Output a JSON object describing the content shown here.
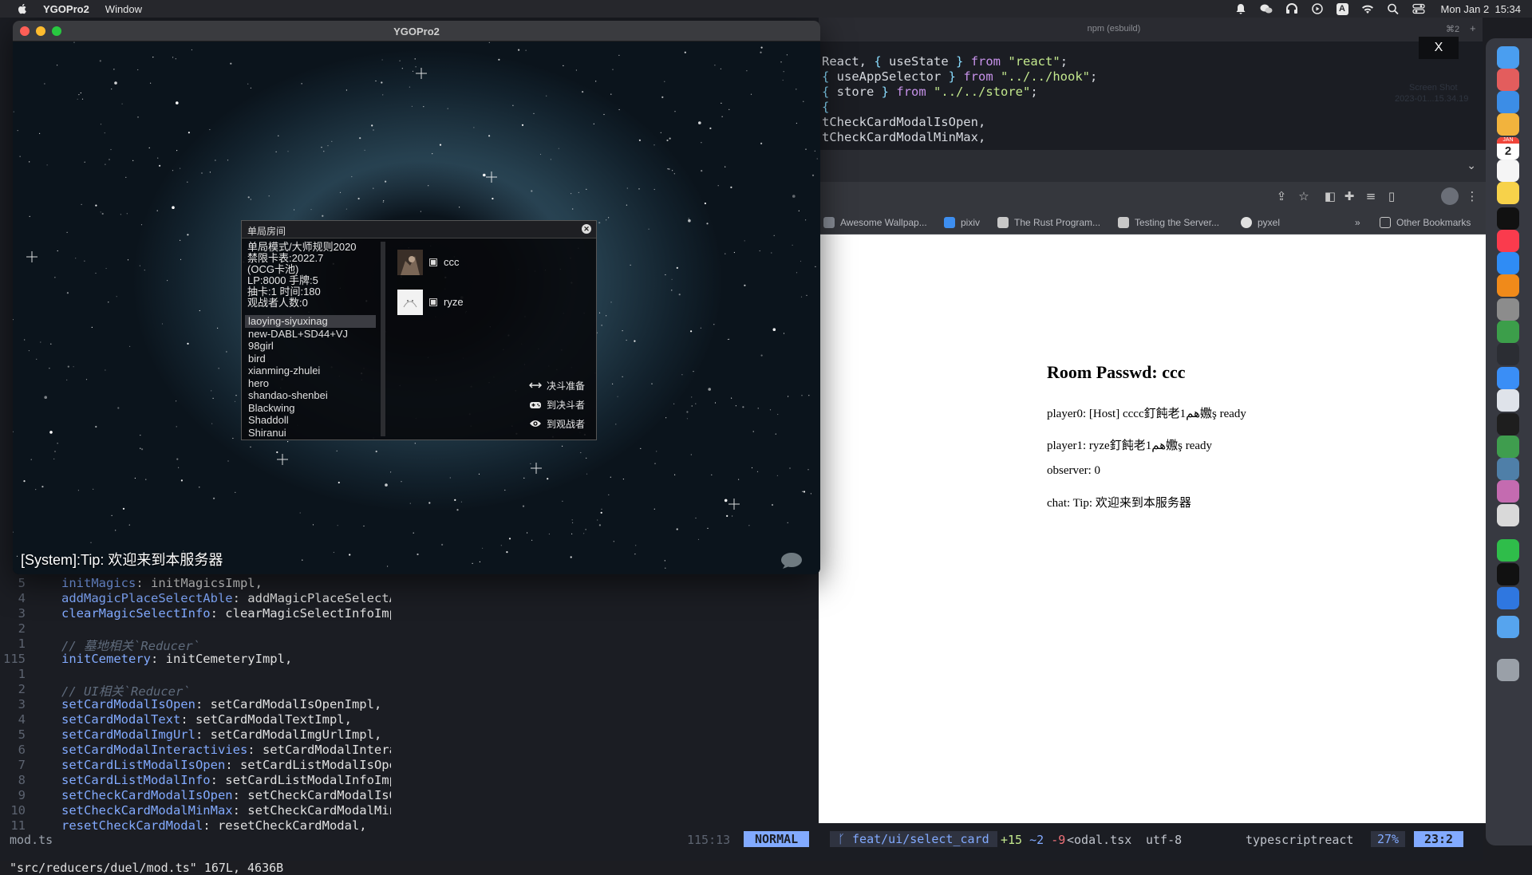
{
  "menubar": {
    "app_name": "YGOPro2",
    "items": [
      "Window"
    ],
    "clock": "Mon Jan 2  15:34",
    "status_icons": [
      "bell-icon",
      "wechat-icon",
      "headphones-icon",
      "play-icon",
      "input-method-icon",
      "wifi-icon",
      "search-icon",
      "control-center-icon"
    ],
    "input_method": "A"
  },
  "terminal": {
    "title": "npm (esbuild)",
    "shortcut": "⌘2",
    "close_label": "X",
    "ghost_text": [
      "Screen Shot",
      "2023-01...15.34.19"
    ],
    "top_code": [
      "React, { useState } from \"react\";",
      "{ useAppSelector } from \"../../hook\";",
      "{ store } from \"../../store\";",
      "{",
      "tCheckCardModalIsOpen,",
      "tCheckCardModalMinMax,"
    ],
    "left_code": [
      {
        "ln": "5",
        "key": "initMagics",
        "val": ": initMagicsImpl,"
      },
      {
        "ln": "4",
        "key": "addMagicPlaceSelectAble",
        "val": ": addMagicPlaceSelectAb"
      },
      {
        "ln": "3",
        "key": "clearMagicSelectInfo",
        "val": ": clearMagicSelectInfoImpl"
      },
      {
        "ln": "2",
        "key": "",
        "val": ""
      },
      {
        "ln": "1",
        "comment": "// 墓地相关`Reducer`"
      },
      {
        "ln": "115",
        "key": "initCemetery",
        "val": ": initCemeteryImpl,"
      },
      {
        "ln": "1",
        "key": "",
        "val": ""
      },
      {
        "ln": "2",
        "comment": "// UI相关`Reducer`"
      },
      {
        "ln": "3",
        "key": "setCardModalIsOpen",
        "val": ": setCardModalIsOpenImpl,"
      },
      {
        "ln": "4",
        "key": "setCardModalText",
        "val": ": setCardModalTextImpl,"
      },
      {
        "ln": "5",
        "key": "setCardModalImgUrl",
        "val": ": setCardModalImgUrlImpl,"
      },
      {
        "ln": "6",
        "key": "setCardModalInteractivies",
        "val": ": setCardModalInterac"
      },
      {
        "ln": "7",
        "key": "setCardListModalIsOpen",
        "val": ": setCardListModalIsOpen"
      },
      {
        "ln": "8",
        "key": "setCardListModalInfo",
        "val": ": setCardListModalInfoImpl"
      },
      {
        "ln": "9",
        "key": "setCheckCardModalIsOpen",
        "val": ": setCheckCardModalIsOp"
      },
      {
        "ln": "10",
        "key": "setCheckCardModalMinMax",
        "val": ": setCheckCardModalMinM"
      },
      {
        "ln": "11",
        "key": "resetCheckCardModal",
        "val": ": resetCheckCardModal,"
      }
    ],
    "status": {
      "file": "mod.ts",
      "pos": "115:13",
      "mode": "NORMAL",
      "branch": "feat/ui/select_card",
      "diff_add": "+15",
      "diff_mod": "~2",
      "diff_del": "-9",
      "buffer": "<odal.tsx",
      "encoding": "utf-8",
      "filetype": "typescriptreact",
      "percent": "27%",
      "cursor": "23:2"
    },
    "cmdline": "\"src/reducers/duel/mod.ts\" 167L, 4636B"
  },
  "browser": {
    "bookmarks": [
      {
        "label": "Awesome Wallpap...",
        "icon": "wallpaper-icon",
        "color": "#8a8f99"
      },
      {
        "label": "pixiv",
        "icon": "pixiv-icon",
        "color": "#3d8ef0"
      },
      {
        "label": "The Rust Program...",
        "icon": "book-icon",
        "color": "#c8c8c8"
      },
      {
        "label": "Testing the Server...",
        "icon": "book-icon",
        "color": "#c8c8c8"
      },
      {
        "label": "pyxel",
        "icon": "github-icon",
        "color": "#e0e0e0"
      }
    ],
    "other_bookmarks": "Other Bookmarks",
    "page": {
      "title": "Room Passwd: ccc",
      "player0": "player0: [Host] cccc釘飩老1هم嫐ş  ready",
      "player1": "player1: ryze釘飩老1هم嫐ş  ready",
      "observer": "observer: 0",
      "chat": "chat: Tip: 欢迎来到本服务器"
    }
  },
  "game": {
    "window_title": "YGOPro2",
    "system_message": "[System]:Tip: 欢迎来到本服务器",
    "room": {
      "title": "单局房间",
      "info": [
        "单局模式/大师规则2020",
        "禁限卡表:2022.7",
        "(OCG卡池)",
        "LP:8000 手牌:5",
        "抽卡:1 时间:180",
        "观战者人数:0"
      ],
      "decks": [
        "laoying-siyuxinag",
        "new-DABL+SD44+VJ",
        "98girl",
        "bird",
        "xianming-zhulei",
        "hero",
        "shandao-shenbei",
        "Blackwing",
        "Shaddoll",
        "Shiranui"
      ],
      "selected_deck": 0,
      "players": [
        {
          "name": "ccc",
          "ready": true
        },
        {
          "name": "ryze",
          "ready": true
        }
      ],
      "actions": {
        "duel_ready": "决斗准备",
        "to_duelist": "到决斗者",
        "to_observer": "到观战者"
      }
    }
  },
  "dock": {
    "apps": [
      {
        "name": "finder-icon",
        "color": "#4a9ef0"
      },
      {
        "name": "launchpad-icon",
        "color": "#e35d5d"
      },
      {
        "name": "mail-icon",
        "color": "#3c8de6"
      },
      {
        "name": "photos-icon",
        "color": "#f2b33d"
      },
      {
        "name": "calendar-icon",
        "color": "#ffffff"
      },
      {
        "name": "reminders-icon",
        "color": "#f5f5f5"
      },
      {
        "name": "notes-icon",
        "color": "#f7d24a"
      },
      {
        "name": "appletv-icon",
        "color": "#111111"
      },
      {
        "name": "music-icon",
        "color": "#fa3b4d"
      },
      {
        "name": "appstore-icon",
        "color": "#2f8cf5"
      },
      {
        "name": "vlc-icon",
        "color": "#f08a1a"
      },
      {
        "name": "settings-icon",
        "color": "#8c8c8c"
      },
      {
        "name": "chrome-icon",
        "color": "#3c9e4a"
      },
      {
        "name": "activity-icon",
        "color": "#2b2d33"
      },
      {
        "name": "qq-browser-icon",
        "color": "#3a8ef6"
      },
      {
        "name": "preview-icon",
        "color": "#dfe3ea"
      },
      {
        "name": "terminal-icon",
        "color": "#1e1e1e"
      },
      {
        "name": "neovim-icon",
        "color": "#3f9d4e"
      },
      {
        "name": "game-icon",
        "color": "#4f7fa8"
      },
      {
        "name": "anime-icon",
        "color": "#c46bb0"
      },
      {
        "name": "cat-icon",
        "color": "#d9d9d9"
      },
      {
        "name": "wechat-icon",
        "color": "#2fbd4a"
      },
      {
        "name": "qq-icon",
        "color": "#111111"
      },
      {
        "name": "mail-client-icon",
        "color": "#2f77e0"
      },
      {
        "name": "folder-icon",
        "color": "#56a4ee"
      },
      {
        "name": "trash-icon",
        "color": "#9aa0a8"
      }
    ],
    "calendar_day": "2",
    "calendar_month": "JAN"
  }
}
